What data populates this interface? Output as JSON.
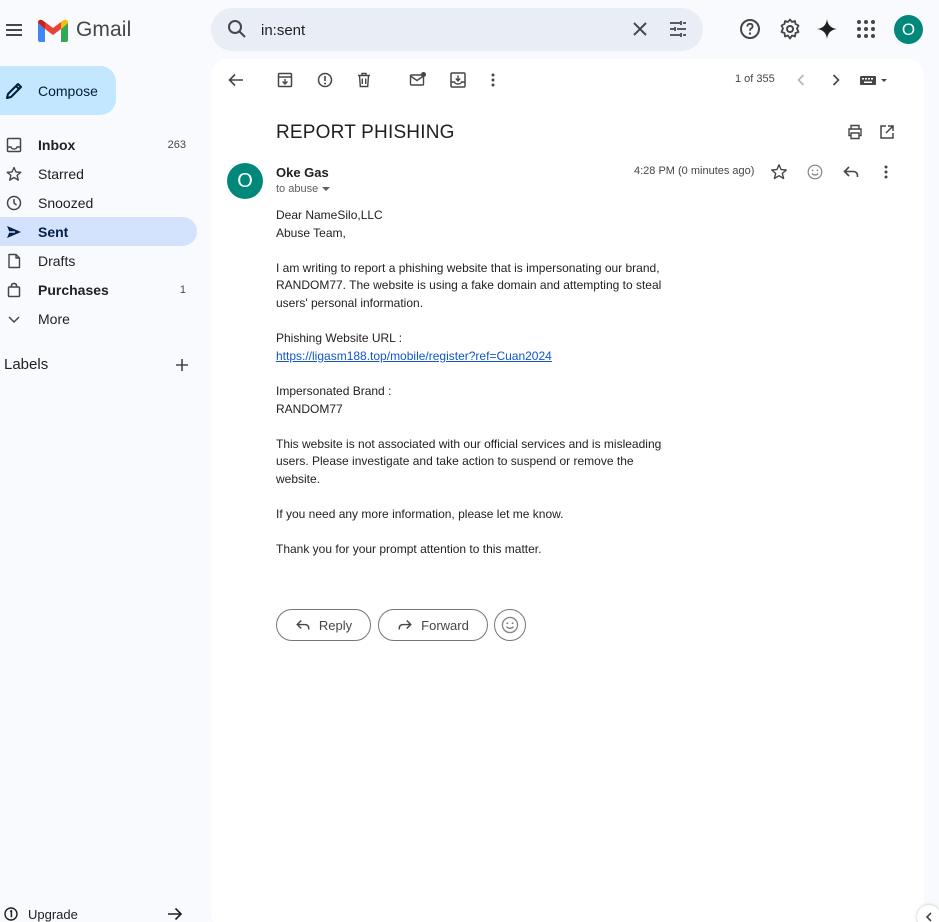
{
  "app": {
    "name": "Gmail"
  },
  "search": {
    "query": "in:sent"
  },
  "compose": {
    "label": "Compose"
  },
  "sidebar": {
    "items": [
      {
        "label": "Inbox",
        "count": "263",
        "icon": "inbox-icon"
      },
      {
        "label": "Starred",
        "count": "",
        "icon": "star-icon"
      },
      {
        "label": "Snoozed",
        "count": "",
        "icon": "clock-icon"
      },
      {
        "label": "Sent",
        "count": "",
        "icon": "send-icon"
      },
      {
        "label": "Drafts",
        "count": "",
        "icon": "draft-icon"
      },
      {
        "label": "Purchases",
        "count": "1",
        "icon": "bag-icon"
      },
      {
        "label": "More",
        "count": "",
        "icon": "chevron-down-icon"
      }
    ],
    "labels_title": "Labels",
    "upgrade_label": "Upgrade"
  },
  "toolbar": {
    "pager": "1 of 355"
  },
  "message": {
    "subject": "REPORT PHISHING",
    "sender_initial": "O",
    "sender_name": "Oke Gas",
    "to": "to abuse",
    "time": "4:28 PM (0 minutes ago)",
    "body": {
      "greeting_1": "Dear NameSilo,LLC",
      "greeting_2": "Abuse Team,",
      "p1": "I am writing to report a phishing website that is impersonating our brand, RANDOM77. The website is using a fake domain and attempting to steal users' personal information.",
      "url_label": "Phishing Website URL :",
      "url": "https://ligasm188.top/mobile/register?ref=Cuan2024",
      "brand_label": "Impersonated Brand :",
      "brand": "RANDOM77",
      "p2": "This website is not associated with our official services and is misleading users. Please investigate and take action to suspend or remove the website.",
      "p3": "If you need any more information, please let me know.",
      "p4": "Thank you for your prompt attention to this matter."
    },
    "reply_label": "Reply",
    "forward_label": "Forward"
  },
  "user": {
    "initial": "O"
  },
  "colors": {
    "accent": "#00897b",
    "compose_bg": "#c2e7ff",
    "active_nav": "#d3e3fd",
    "link": "#1155cc"
  }
}
